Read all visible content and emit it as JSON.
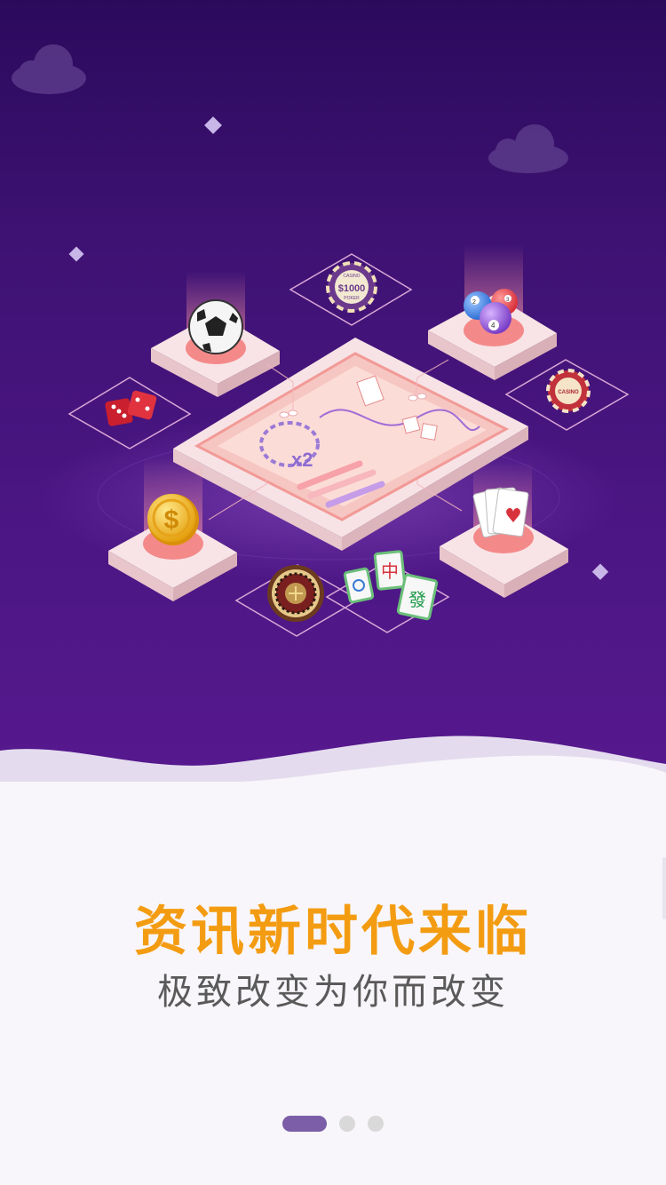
{
  "colors": {
    "bg_top": "#2b0a5c",
    "bg_bottom": "#57198f",
    "title": "#f39c12",
    "subtitle": "#5a5a5a",
    "dot_active": "#7c5ea8",
    "dot_inactive": "#d9d9d9"
  },
  "illustration": {
    "chip_large_label": "$1000",
    "chip_large_top": "CASINO",
    "chip_large_bottom": "POKER",
    "chip_small_label": "CASINO",
    "multiplier": "x2",
    "ball_numbers": [
      "2",
      "4",
      "3"
    ],
    "mahjong_tiles": [
      "中",
      "發"
    ],
    "coin_symbol": "$",
    "card_suit": "♥"
  },
  "intro": {
    "title": "资讯新时代来临",
    "subtitle": "极致改变为你而改变"
  },
  "pager": {
    "pages": 3,
    "current": 0
  }
}
